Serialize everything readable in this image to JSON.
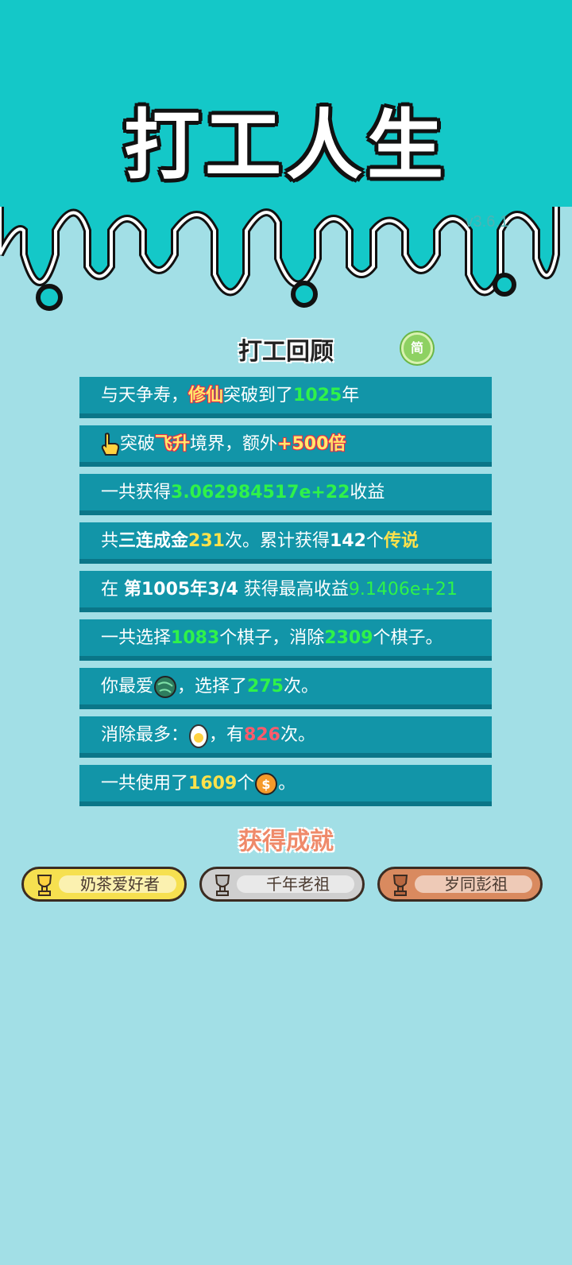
{
  "header": {
    "title": "打工人生",
    "version": "v3.6.1"
  },
  "review": {
    "title": "打工回顾",
    "lang_toggle": "简"
  },
  "rows": [
    {
      "p1": "与天争寿，",
      "h1": "修仙",
      "p2": "突破到了",
      "h2": "1025",
      "p3": "年"
    },
    {
      "p1": "突破",
      "h1": "飞升",
      "p2": "境界，额外",
      "h2": "+500倍"
    },
    {
      "p1": "一共获得",
      "h1": "3.062984517e+22",
      "p2": "收益"
    },
    {
      "p1": "共",
      "h1": "三连成金",
      "h2": "231",
      "p2": "次。累计获得",
      "h3": "142",
      "p3": "个",
      "h4": "传说"
    },
    {
      "p1": "在 ",
      "h1": "第1005年3/4",
      "p2": " 获得最高收益",
      "h2": "9.1406e+21"
    },
    {
      "p1": "一共选择",
      "h1": "1083",
      "p2": "个棋子，消除",
      "h2": "2309",
      "p3": "个棋子。"
    },
    {
      "p1": "你最爱",
      "p2": "，选择了",
      "h1": "275",
      "p3": "次。"
    },
    {
      "p1": "消除最多：",
      "p2": "，有",
      "h1": "826",
      "p3": "次。"
    },
    {
      "p1": "一共使用了",
      "h1": "1609",
      "p2": "个",
      "p3": "。"
    }
  ],
  "achievements": {
    "title": "获得成就",
    "items": [
      {
        "label": "奶茶爱好者",
        "tier": "gold"
      },
      {
        "label": "千年老祖",
        "tier": "silver"
      },
      {
        "label": "岁同彭祖",
        "tier": "bronze"
      }
    ]
  },
  "colors": {
    "header_bg": "#14c8c8",
    "page_bg": "#a2dfe6",
    "row_bg": "#1295a8",
    "highlight_green": "#2ff24a",
    "highlight_yellow": "#ffe14a",
    "highlight_red": "#ff5b6b"
  },
  "icons": {
    "row2": "pointing-hand-icon",
    "row7": "green-planet-icon",
    "row8": "egg-icon",
    "row9": "coin-icon"
  }
}
